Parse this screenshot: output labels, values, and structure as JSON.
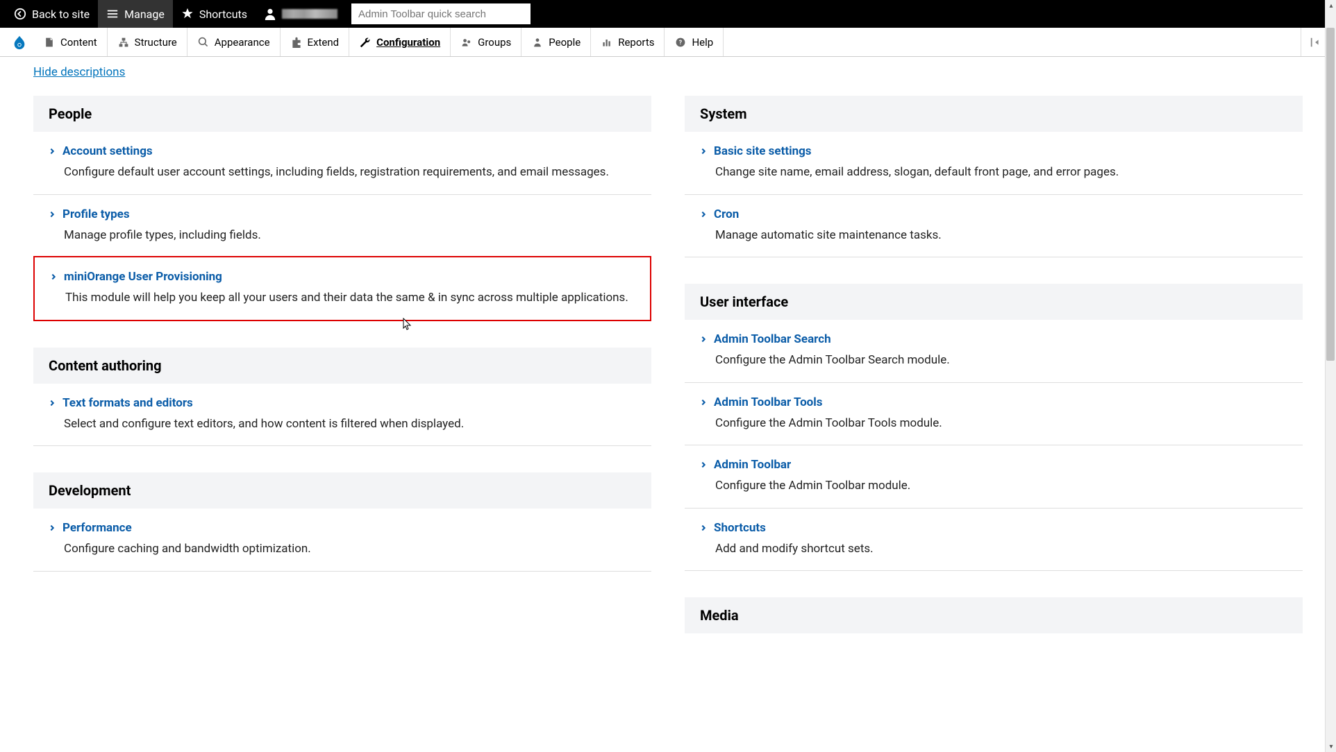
{
  "top_toolbar": {
    "back_to_site": "Back to site",
    "manage": "Manage",
    "shortcuts": "Shortcuts",
    "search_placeholder": "Admin Toolbar quick search"
  },
  "admin_menu": {
    "items": [
      {
        "label": "Content"
      },
      {
        "label": "Structure"
      },
      {
        "label": "Appearance"
      },
      {
        "label": "Extend"
      },
      {
        "label": "Configuration"
      },
      {
        "label": "Groups"
      },
      {
        "label": "People"
      },
      {
        "label": "Reports"
      },
      {
        "label": "Help"
      }
    ]
  },
  "hide_descriptions": "Hide descriptions",
  "left_sections": [
    {
      "title": "People",
      "items": [
        {
          "title": "Account settings",
          "desc": "Configure default user account settings, including fields, registration requirements, and email messages."
        },
        {
          "title": "Profile types",
          "desc": "Manage profile types, including fields."
        },
        {
          "title": "miniOrange User Provisioning",
          "desc": "This module will help you keep all your users and their data the same & in sync across multiple applications.",
          "highlighted": true
        }
      ]
    },
    {
      "title": "Content authoring",
      "items": [
        {
          "title": "Text formats and editors",
          "desc": "Select and configure text editors, and how content is filtered when displayed."
        }
      ]
    },
    {
      "title": "Development",
      "items": [
        {
          "title": "Performance",
          "desc": "Configure caching and bandwidth optimization."
        }
      ]
    }
  ],
  "right_sections": [
    {
      "title": "System",
      "items": [
        {
          "title": "Basic site settings",
          "desc": "Change site name, email address, slogan, default front page, and error pages."
        },
        {
          "title": "Cron",
          "desc": "Manage automatic site maintenance tasks."
        }
      ]
    },
    {
      "title": "User interface",
      "items": [
        {
          "title": "Admin Toolbar Search",
          "desc": "Configure the Admin Toolbar Search module."
        },
        {
          "title": "Admin Toolbar Tools",
          "desc": "Configure the Admin Toolbar Tools module."
        },
        {
          "title": "Admin Toolbar",
          "desc": "Configure the Admin Toolbar module."
        },
        {
          "title": "Shortcuts",
          "desc": "Add and modify shortcut sets."
        }
      ]
    },
    {
      "title": "Media",
      "items": []
    }
  ]
}
